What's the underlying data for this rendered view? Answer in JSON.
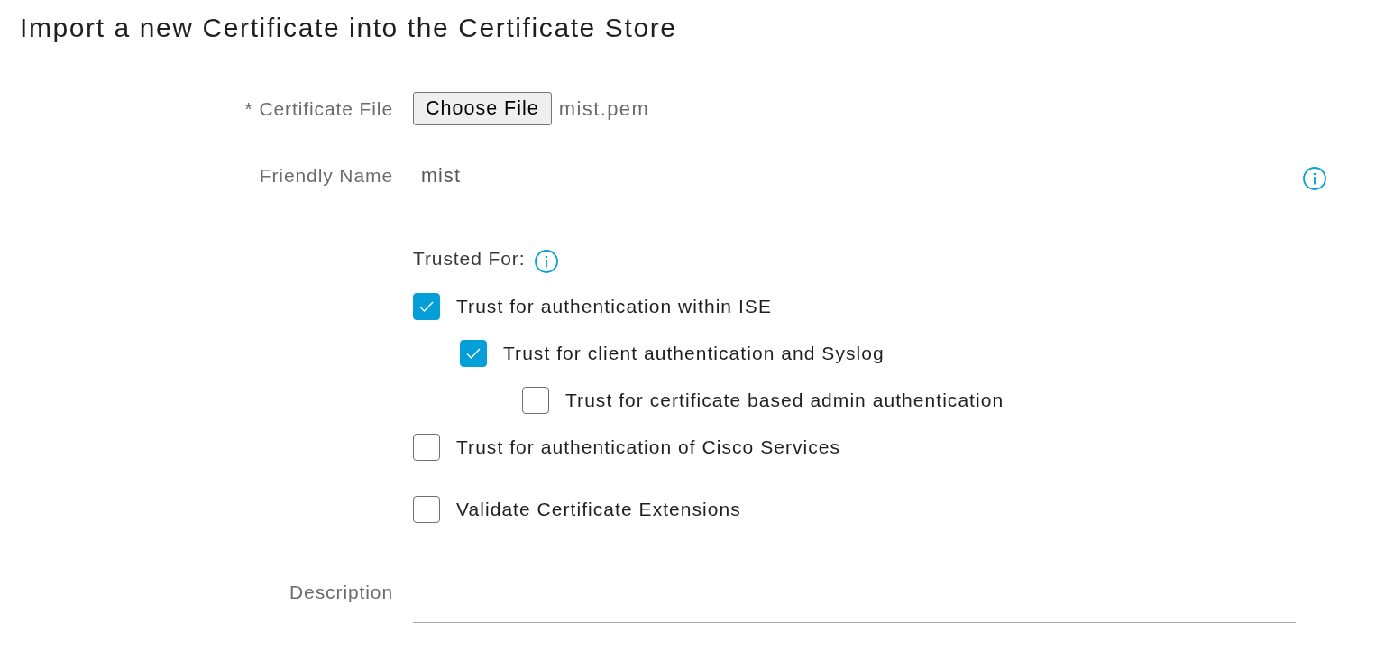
{
  "title": "Import a new Certificate into the Certificate Store",
  "certificate_file": {
    "label": "* Certificate File",
    "button": "Choose File",
    "file_name": "mist.pem"
  },
  "friendly_name": {
    "label": "Friendly Name",
    "value": "mist"
  },
  "trusted_for": {
    "label": "Trusted For:",
    "options": [
      {
        "label": "Trust for authentication within ISE",
        "checked": true,
        "children": [
          {
            "label": "Trust for client authentication and Syslog",
            "checked": true,
            "children": [
              {
                "label": "Trust for certificate based admin authentication",
                "checked": false
              }
            ]
          }
        ]
      },
      {
        "label": "Trust for authentication of Cisco Services",
        "checked": false
      }
    ]
  },
  "validate_certificate_extensions": {
    "label": "Validate Certificate Extensions",
    "checked": false
  },
  "description": {
    "label": "Description"
  }
}
